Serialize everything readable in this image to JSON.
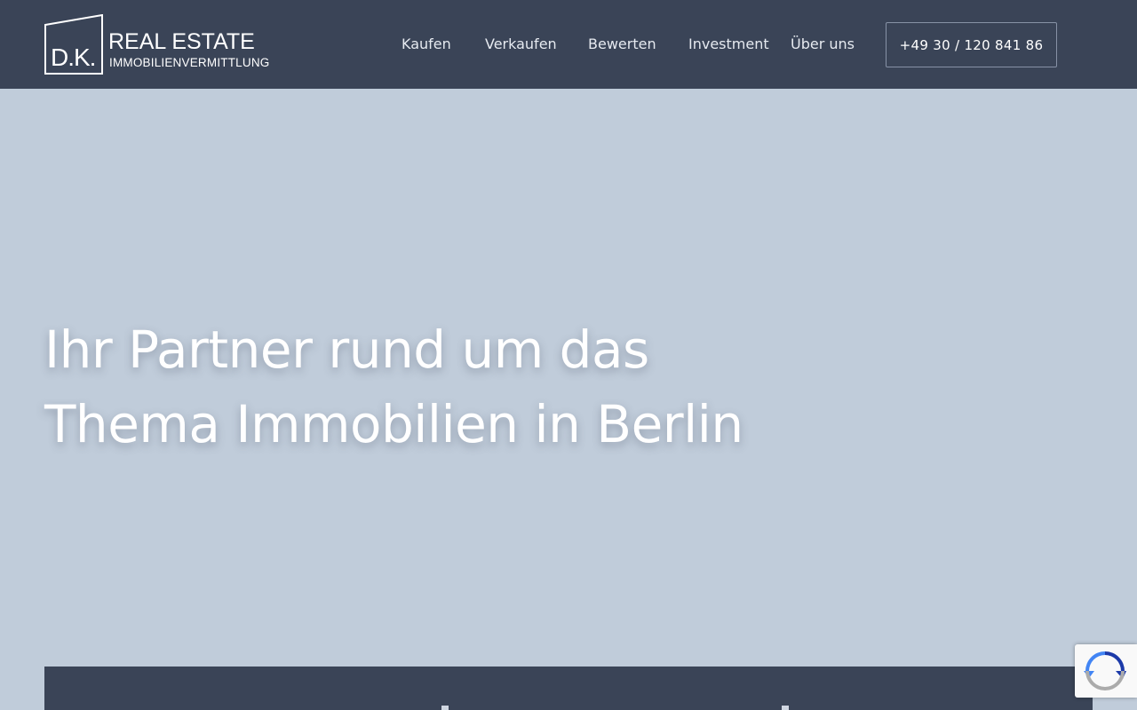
{
  "header": {
    "logo": {
      "mark": "D.K.",
      "title": "REAL ESTATE",
      "subtitle": "IMMOBILIENVERMITTLUNG"
    },
    "nav": [
      {
        "label": "Kaufen"
      },
      {
        "label": "Verkaufen"
      },
      {
        "label": "Bewerten"
      },
      {
        "label": "Investment"
      },
      {
        "label": "Über uns"
      }
    ],
    "phone": "+49 30 / 120 841 86"
  },
  "hero": {
    "title_line1": "Ihr Partner rund um das",
    "title_line2": "Thema Immobilien in Berlin"
  },
  "icons": {
    "recaptcha": "recaptcha-icon"
  },
  "colors": {
    "header_bg": "#3a4457",
    "hero_bg": "#c0ccda",
    "text_light": "#ffffff"
  }
}
